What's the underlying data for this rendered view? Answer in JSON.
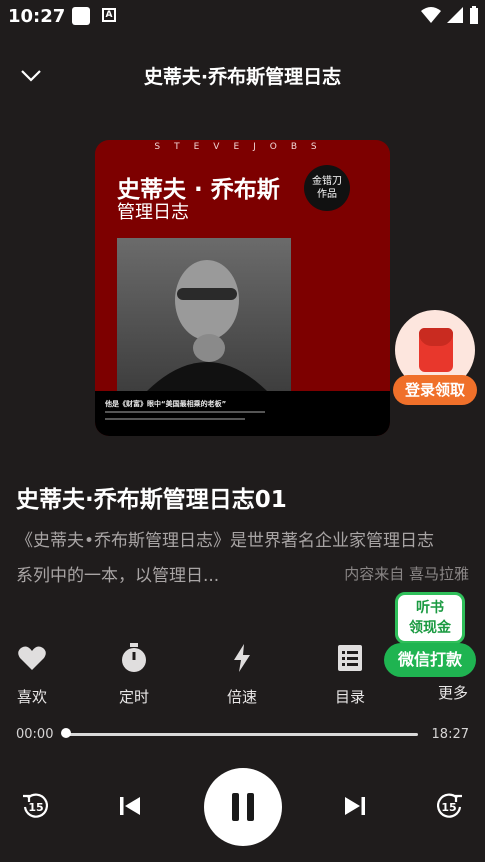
{
  "status_bar": {
    "time": "10:27"
  },
  "header": {
    "title": "史蒂夫·乔布斯管理日志"
  },
  "cover": {
    "top_text": "STEVEJOBS",
    "title_line1": "史蒂夫 · 乔布斯",
    "title_line2": "管理日志",
    "badge_line1": "金错刀",
    "badge_line2": "作品",
    "caption": "他是《财富》眼中“美国最相乘的老板”"
  },
  "promo": {
    "envelope_label": "登录领取",
    "book_line1": "听书",
    "book_line2": "领现金",
    "wechat_label": "微信打款"
  },
  "track": {
    "title": "史蒂夫·乔布斯管理日志01",
    "desc_line1": "《史蒂夫•乔布斯管理日志》是世界著名企业家管理日志",
    "desc_line2": "系列中的一本，以管理日...",
    "source": "内容来自 喜马拉雅"
  },
  "actions": [
    {
      "label": "喜欢",
      "icon": "heart-icon"
    },
    {
      "label": "定时",
      "icon": "timer-icon"
    },
    {
      "label": "倍速",
      "icon": "lightning-icon"
    },
    {
      "label": "目录",
      "icon": "list-icon"
    },
    {
      "label": "更多",
      "icon": "more-icon"
    }
  ],
  "progress": {
    "current": "00:00",
    "total": "18:27",
    "fraction": 0.0
  },
  "controls": {
    "rewind_seconds": "15",
    "forward_seconds": "15"
  },
  "colors": {
    "background": "#1f1c1c",
    "cover": "#7d0000",
    "accent_orange": "#f0702a",
    "accent_green": "#1fb451"
  }
}
